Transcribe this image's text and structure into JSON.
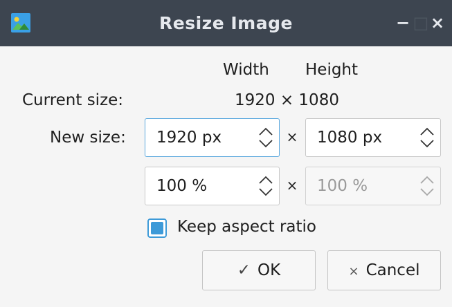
{
  "window": {
    "title": "Resize Image",
    "icon": "image-icon",
    "controls": {
      "minimize": "−",
      "maximize": "□",
      "close": "×"
    }
  },
  "headers": {
    "width": "Width",
    "height": "Height"
  },
  "current": {
    "label": "Current size:",
    "value": "1920 × 1080"
  },
  "new_size": {
    "label": "New size:",
    "width_px": "1920 px",
    "height_px": "1080 px",
    "width_pct": "100 %",
    "height_pct": "100 %",
    "times": "×"
  },
  "keep_aspect": {
    "label": "Keep aspect ratio",
    "checked": true
  },
  "buttons": {
    "ok_icon": "✓",
    "ok_label": "OK",
    "cancel_icon": "×",
    "cancel_label": "Cancel"
  },
  "colors": {
    "titlebar": "#3d4550",
    "accent": "#3d9ad8"
  }
}
